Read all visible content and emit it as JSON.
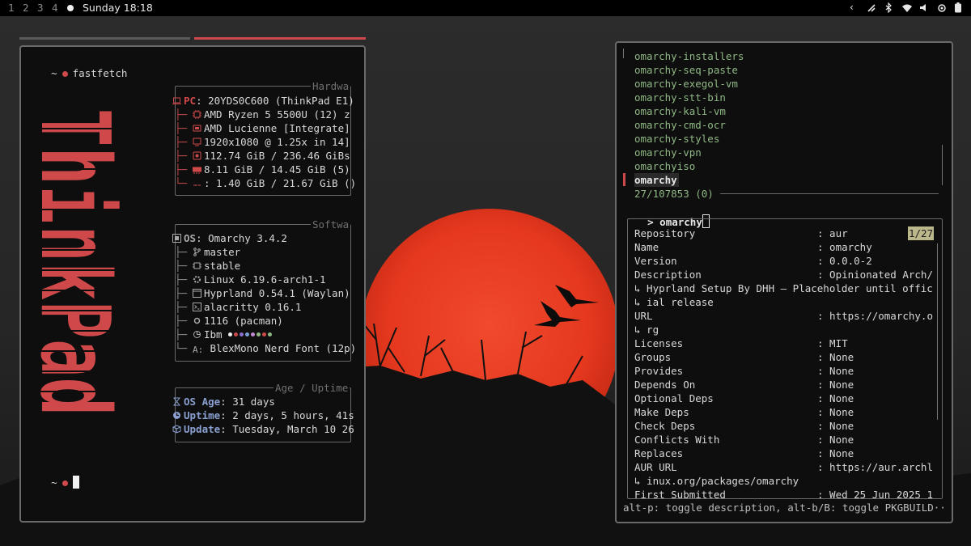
{
  "topbar": {
    "workspaces": [
      "1",
      "2",
      "3",
      "4"
    ],
    "clock": "Sunday 18:18",
    "icons": [
      "arrow-left-icon",
      "signal-icon",
      "bluetooth-icon",
      "wifi-icon",
      "volume-icon",
      "cpu-icon",
      "battery-icon"
    ]
  },
  "colors": {
    "accent": "#d0494a",
    "green": "#8fb884",
    "border": "#6a6a6a"
  },
  "left_terminal": {
    "prompt_symbol": "~",
    "command": "fastfetch",
    "logo_text": "ThinkPad",
    "hardware": {
      "title": "Hardwa",
      "pc_label": "PC",
      "pc_value": "20YDS0C600 (ThinkPad E1)",
      "rows": [
        {
          "icon": "cpu-icon",
          "value": "AMD Ryzen 5 5500U (12) z"
        },
        {
          "icon": "gpu-icon",
          "value": "AMD Lucienne [Integrate]"
        },
        {
          "icon": "display-icon",
          "value": "1920x1080 @ 1.25x in 14]"
        },
        {
          "icon": "disk-icon",
          "value": "112.74 GiB / 236.46 GiBs"
        },
        {
          "icon": "memory-icon",
          "value": "8.11 GiB / 14.45 GiB (5)"
        },
        {
          "icon": "swap-icon",
          "value": ": 1.40 GiB / 21.67 GiB ()"
        }
      ]
    },
    "software": {
      "title": "Softwa",
      "os_label": "OS",
      "os_value": "Omarchy 3.4.2",
      "rows": [
        {
          "icon": "branch-icon",
          "value": "master"
        },
        {
          "icon": "channel-icon",
          "value": "stable"
        },
        {
          "icon": "kernel-icon",
          "value": "Linux 6.19.6-arch1-1"
        },
        {
          "icon": "window-manager-icon",
          "value": "Hyprland 0.54.1 (Waylan)"
        },
        {
          "icon": "terminal-icon",
          "value": "alacritty 0.16.1"
        },
        {
          "icon": "package-icon",
          "value": "1116 (pacman)"
        },
        {
          "icon": "theme-icon",
          "value": "Ibm"
        },
        {
          "icon": "font-icon",
          "value": "BlexMono Nerd Font (12p)"
        }
      ],
      "palette": [
        "#f0f0f0",
        "#d0494a",
        "#8a6ed0",
        "#7aa0d8",
        "#c08ad0",
        "#8fb884",
        "#d0c070",
        "#b0b0b0"
      ]
    },
    "uptime": {
      "title": "Age / Uptime",
      "rows": [
        {
          "icon": "hourglass-icon",
          "label": "OS Age",
          "value": ": 31 days"
        },
        {
          "icon": "clock-icon",
          "label": "Uptime",
          "value": ": 2 days, 5 hours, 41s"
        },
        {
          "icon": "box-icon",
          "label": "Update",
          "value": ": Tuesday, March 10 26"
        }
      ]
    }
  },
  "right_terminal": {
    "results": [
      "omarchy-installers",
      "omarchy-seq-paste",
      "omarchy-exegol-vm",
      "omarchy-stt-bin",
      "omarchy-kali-vm",
      "omarchy-cmd-ocr",
      "omarchy-styles",
      "omarchy-vpn",
      "omarchyiso"
    ],
    "selected": "omarchy",
    "count": "27/107853 (0)",
    "prompt": ">",
    "query": "omarchy",
    "position_badge": "1/27",
    "info": [
      {
        "key": "Repository",
        "value": ": aur"
      },
      {
        "key": "Name",
        "value": ": omarchy"
      },
      {
        "key": "Version",
        "value": ": 0.0.0-2"
      },
      {
        "key": "Description",
        "value": ": Opinionated Arch/"
      },
      {
        "wrap": "↳ Hyprland Setup By DHH — Placeholder until offic"
      },
      {
        "wrap": "↳ ial release"
      },
      {
        "key": "URL",
        "value": ": https://omarchy.o"
      },
      {
        "wrap": "↳ rg"
      },
      {
        "key": "Licenses",
        "value": ": MIT"
      },
      {
        "key": "Groups",
        "value": ": None"
      },
      {
        "key": "Provides",
        "value": ": None"
      },
      {
        "key": "Depends On",
        "value": ": None"
      },
      {
        "key": "Optional Deps",
        "value": ": None"
      },
      {
        "key": "Make Deps",
        "value": ": None"
      },
      {
        "key": "Check Deps",
        "value": ": None"
      },
      {
        "key": "Conflicts With",
        "value": ": None"
      },
      {
        "key": "Replaces",
        "value": ": None"
      },
      {
        "key": "AUR URL",
        "value": ": https://aur.archl"
      },
      {
        "wrap": "↳ inux.org/packages/omarchy"
      },
      {
        "key": "First Submitted",
        "value": ": Wed 25 Jun 2025 1"
      }
    ],
    "footer": "alt-p: toggle description, alt-b/B: toggle PKGBUILD··"
  }
}
